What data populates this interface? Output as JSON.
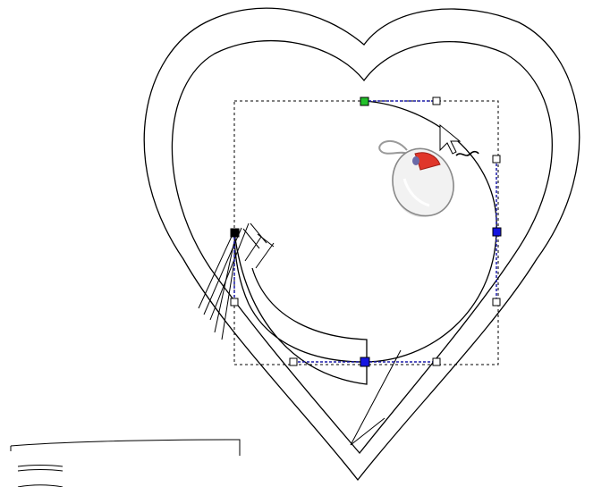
{
  "colors": {
    "canvas_bg": "#ffffff",
    "stroke": "#000000",
    "selected_node": "#1515e0",
    "start_node": "#22c02a",
    "control_handle": "#ffffff",
    "handle_line": "#1a1aa8",
    "mouse_left_button": "#e0362a",
    "mouse_body": "#f2f2f2"
  },
  "cursor": {
    "icon": "mouse-drag-cursor-icon",
    "pressed_button": "left"
  },
  "tool": "shape-node-editing"
}
